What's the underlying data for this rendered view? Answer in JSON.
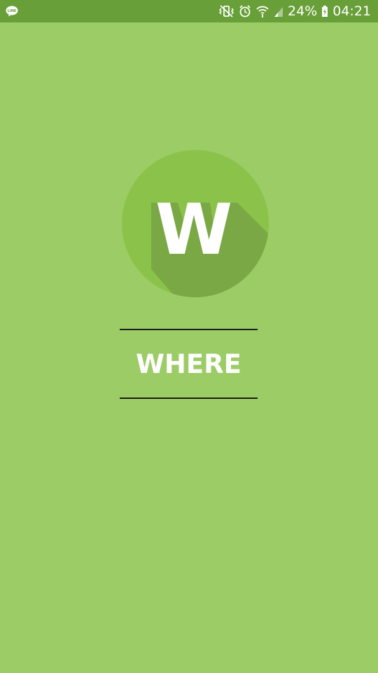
{
  "status_bar": {
    "notification_icon": "line-app-icon",
    "icons": [
      "vibrate-icon",
      "alarm-icon",
      "wifi-icon",
      "signal-icon"
    ],
    "battery_percent": "24%",
    "battery_icon": "battery-charging-icon",
    "time": "04:21"
  },
  "splash": {
    "logo_letter": "W",
    "app_name": "WHERE"
  },
  "colors": {
    "background": "#9ccc65",
    "status_bar": "#689f38",
    "logo_circle": "#8bc34a",
    "logo_shadow": "#7aa845",
    "text": "#ffffff",
    "divider": "#1b1f14"
  }
}
